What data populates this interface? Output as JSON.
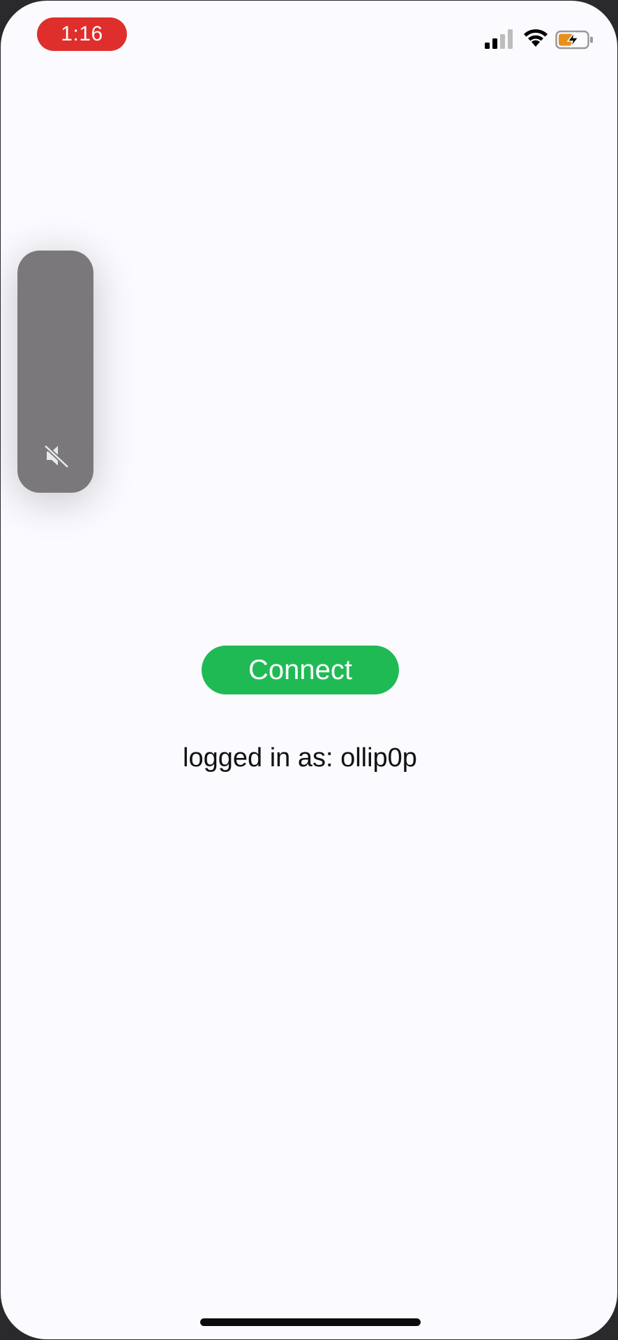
{
  "status_bar": {
    "time": "1:16",
    "signal_icon": "cellular-signal-icon",
    "wifi_icon": "wifi-icon",
    "battery_icon": "battery-charging-icon",
    "time_pill_color": "#df2f2c",
    "battery_color": "#e8901c"
  },
  "mute_hud": {
    "icon": "speaker-muted-icon"
  },
  "main": {
    "connect_label": "Connect",
    "connect_color": "#20ba55",
    "login_status": "logged in as: ollip0p"
  }
}
